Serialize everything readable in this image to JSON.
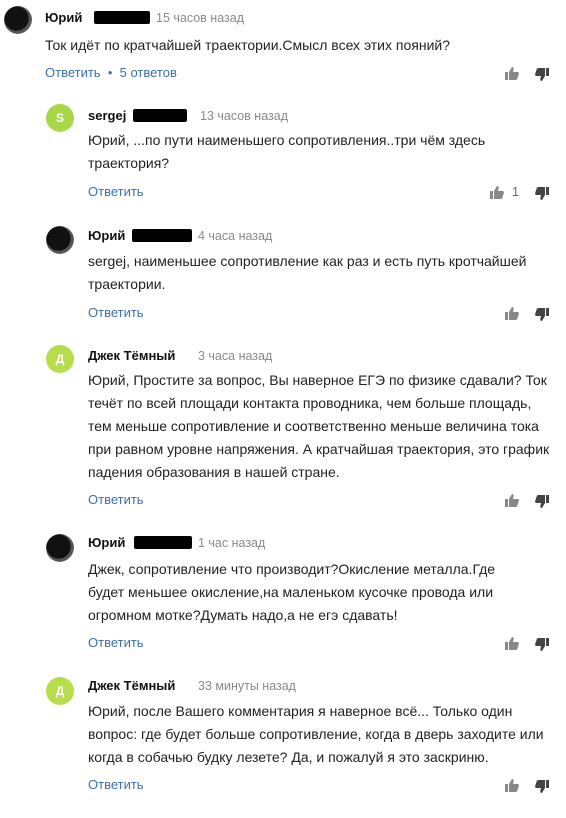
{
  "colors": {
    "link": "#3d6fae",
    "time": "#8a8a8a",
    "avatar_green": "#a8d84a",
    "avatar_green_d": "#b6dd4b"
  },
  "comments": [
    {
      "avatar_icon": "dark-photo",
      "author": "Юрий",
      "time": "15 часов назад",
      "text": "Ток идёт по кратчайшей траектории.Смысл всех этих пояний?",
      "reply": "Ответить",
      "replies_count": "5 ответов",
      "likes": ""
    },
    {
      "avatar_icon": "letter",
      "avatar_letter": "S",
      "author": "sergej",
      "time": "13 часов назад",
      "text": "Юрий, ...по пути наименьшего сопротивления..три чём здесь траектория?",
      "reply": "Ответить",
      "likes": "1"
    },
    {
      "avatar_icon": "dark-photo",
      "author": "Юрий",
      "time": "4 часа назад",
      "text": "sergej, наименьшее сопротивление как раз и есть путь кротчайшей траектории.",
      "reply": "Ответить",
      "likes": ""
    },
    {
      "avatar_icon": "letter",
      "avatar_letter": "Д",
      "author": "Джек Тёмный",
      "time": "3 часа назад",
      "text": "Юрий, Простите за вопрос, Вы наверное ЕГЭ по физике сдавали? Ток течёт по всей площади контакта проводника, чем больше площадь, тем меньше сопротивление и соответственно меньше величина тока при равном уровне напряжения. А кратчайшая траектория, это график падения образования в нашей стране.",
      "reply": "Ответить",
      "likes": ""
    },
    {
      "avatar_icon": "dark-photo",
      "author": "Юрий",
      "time": "1 час назад",
      "text": "Джек, сопротивление что производит?Окисление металла.Где будет меньшее окисление,на маленьком кусочке провода или огромном мотке?Думать надо,а не егэ сдавать!",
      "reply": "Ответить",
      "likes": ""
    },
    {
      "avatar_icon": "letter",
      "avatar_letter": "Д",
      "author": "Джек Тёмный",
      "time": "33 минуты назад",
      "text": "Юрий, после Вашего комментария я наверное всё... Только один вопрос: где будет больше сопротивление, когда в дверь заходите или когда в собачью будку лезете? Да, и пожалуй я это заскриню.",
      "reply": "Ответить",
      "likes": ""
    }
  ]
}
